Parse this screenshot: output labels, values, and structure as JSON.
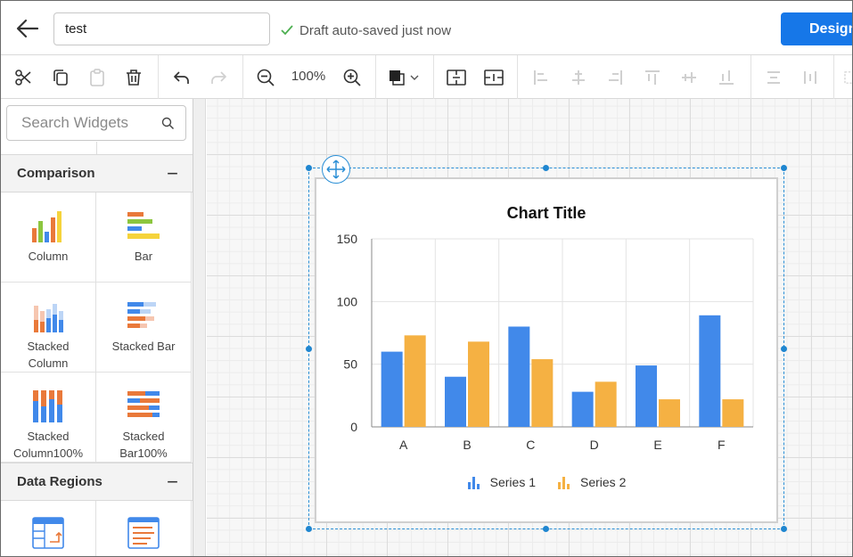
{
  "header": {
    "report_name": "test",
    "save_status": "Draft auto-saved just now",
    "design_label": "Design"
  },
  "toolbar": {
    "zoom": "100%",
    "items": [
      "cut-icon",
      "copy-icon",
      "paste-icon",
      "delete-icon",
      "undo-icon",
      "redo-icon",
      "zoom-out-icon",
      "zoom-in-icon",
      "fill-color-icon",
      "align-icon",
      "distribute-icon"
    ]
  },
  "sidebar": {
    "search_placeholder": "Search Widgets",
    "categories": [
      {
        "label": "Comparison",
        "widgets": [
          {
            "label": "Column",
            "icon": "column-chart-icon"
          },
          {
            "label": "Bar",
            "icon": "bar-chart-icon"
          },
          {
            "label": "Stacked\nColumn",
            "icon": "stacked-column-icon"
          },
          {
            "label": "Stacked Bar",
            "icon": "stacked-bar-icon"
          },
          {
            "label": "Stacked\nColumn100%",
            "icon": "stacked-column100-icon"
          },
          {
            "label": "Stacked\nBar100%",
            "icon": "stacked-bar100-icon"
          }
        ]
      },
      {
        "label": "Data Regions",
        "widgets": [
          {
            "label": "",
            "icon": "table-icon"
          },
          {
            "label": "",
            "icon": "list-icon"
          }
        ]
      }
    ]
  },
  "colors": {
    "accent": "#1677e8",
    "series1": "#4189ea",
    "series2": "#f5b143",
    "selection": "#2b8fd6"
  },
  "chart_data": {
    "type": "bar",
    "title": "Chart Title",
    "categories": [
      "A",
      "B",
      "C",
      "D",
      "E",
      "F"
    ],
    "series": [
      {
        "name": "Series 1",
        "values": [
          60,
          40,
          80,
          28,
          49,
          89
        ]
      },
      {
        "name": "Series 2",
        "values": [
          73,
          68,
          54,
          36,
          22,
          22
        ]
      }
    ],
    "ylim": [
      0,
      150
    ],
    "yticks": [
      0,
      50,
      100,
      150
    ],
    "grid": true,
    "legend": "bottom"
  }
}
